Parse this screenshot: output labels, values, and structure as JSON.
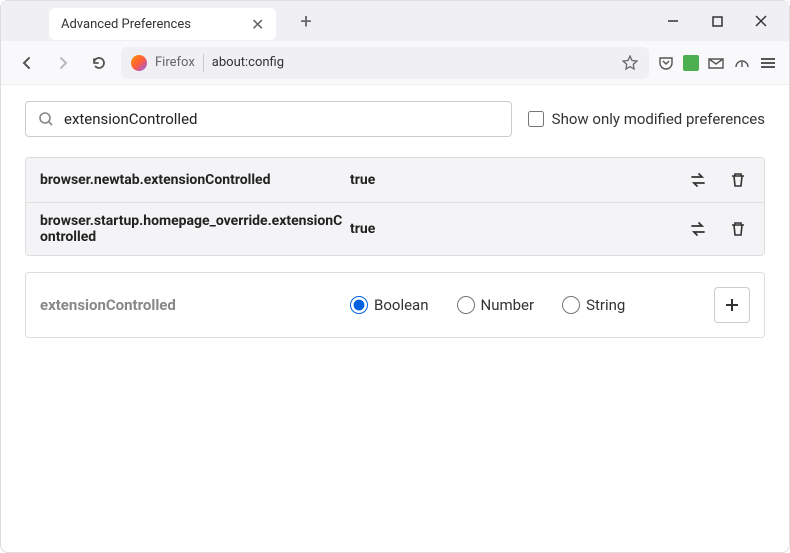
{
  "titleBar": {
    "tabTitle": "Advanced Preferences"
  },
  "urlBar": {
    "brand": "Firefox",
    "url": "about:config"
  },
  "search": {
    "value": "extensionControlled",
    "checkboxLabel": "Show only modified preferences"
  },
  "prefs": [
    {
      "name": "browser.newtab.extensionControlled",
      "value": "true"
    },
    {
      "name": "browser.startup.homepage_override.extensionControlled",
      "value": "true"
    }
  ],
  "newPref": {
    "name": "extensionControlled",
    "types": [
      "Boolean",
      "Number",
      "String"
    ],
    "selected": "Boolean"
  }
}
